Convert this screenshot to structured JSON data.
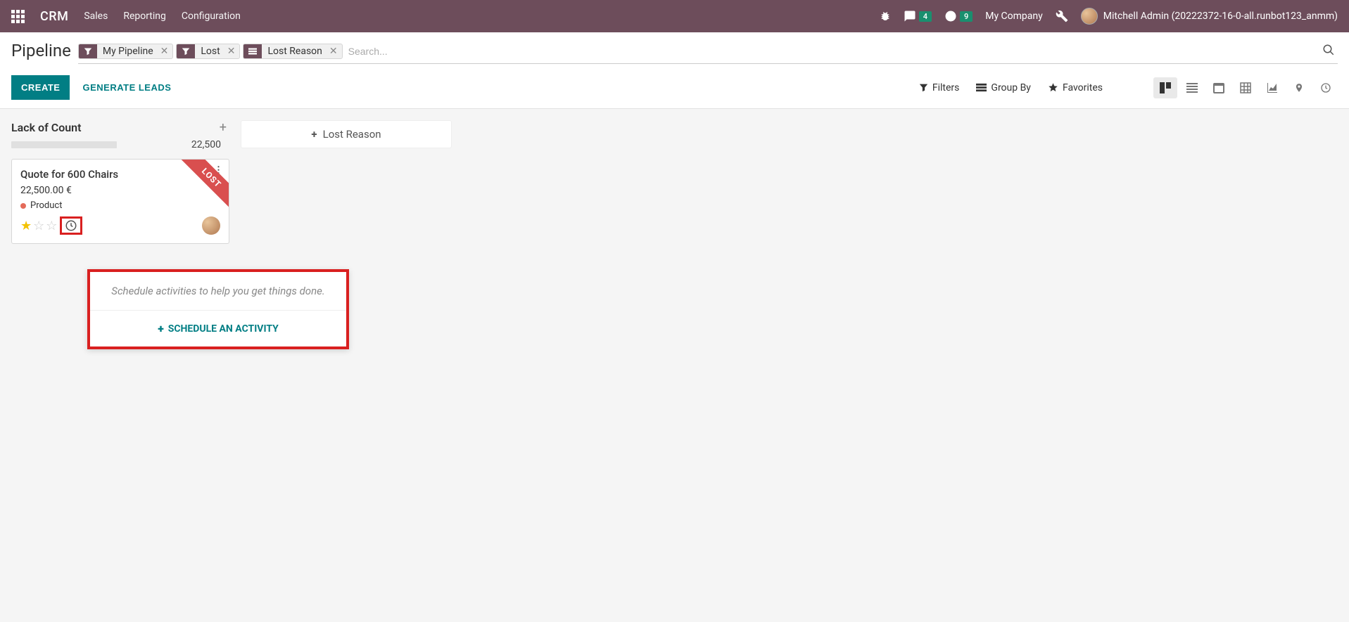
{
  "navbar": {
    "app_title": "CRM",
    "menu": [
      "Sales",
      "Reporting",
      "Configuration"
    ],
    "messaging_badge": "4",
    "activity_badge": "9",
    "company": "My Company",
    "user": "Mitchell Admin (20222372-16-0-all.runbot123_anmm)"
  },
  "control_panel": {
    "title": "Pipeline",
    "create_label": "CREATE",
    "generate_label": "GENERATE LEADS",
    "facets": [
      {
        "type": "filter",
        "label": "My Pipeline"
      },
      {
        "type": "filter",
        "label": "Lost"
      },
      {
        "type": "group",
        "label": "Lost Reason"
      }
    ],
    "search_placeholder": "Search...",
    "toolbar": {
      "filters": "Filters",
      "groupby": "Group By",
      "favorites": "Favorites"
    }
  },
  "kanban": {
    "columns": [
      {
        "title": "Lack of Count",
        "total": "22,500",
        "cards": [
          {
            "title": "Quote for 600 Chairs",
            "amount": "22,500.00 €",
            "tag": "Product",
            "priority": 1,
            "ribbon": "LOST"
          }
        ]
      }
    ],
    "ghost_column_label": "Lost Reason"
  },
  "popover": {
    "hint": "Schedule activities to help you get things done.",
    "action": "SCHEDULE AN ACTIVITY"
  }
}
